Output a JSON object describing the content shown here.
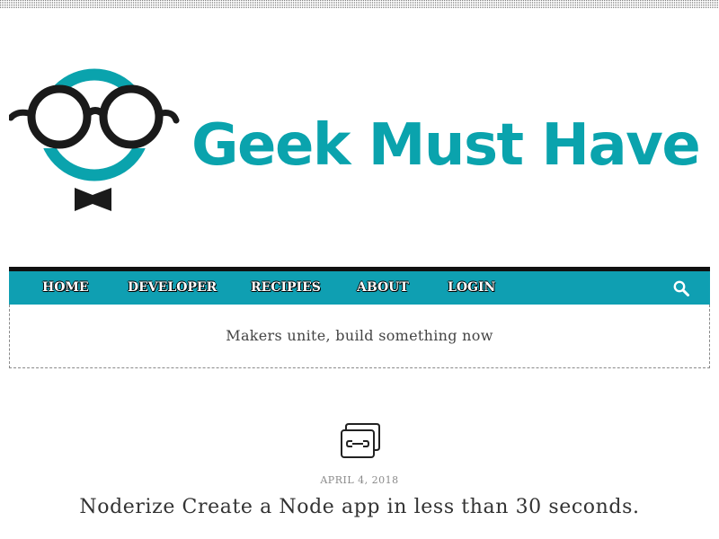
{
  "site": {
    "title": "Geek Must Have",
    "tagline": "Makers unite, build something now"
  },
  "nav": {
    "items": [
      {
        "label": "Home"
      },
      {
        "label": "Developer"
      },
      {
        "label": "Recipies"
      },
      {
        "label": "About"
      },
      {
        "label": "Login"
      }
    ],
    "search_icon": "search-icon"
  },
  "post": {
    "format_icon": "link-icon",
    "date": "April 4, 2018",
    "title": "Noderize Create a Node app in less than 30 seconds."
  },
  "colors": {
    "brand": "#0aa3ad",
    "nav_background": "#0f9fb2",
    "nav_border": "#111111"
  }
}
